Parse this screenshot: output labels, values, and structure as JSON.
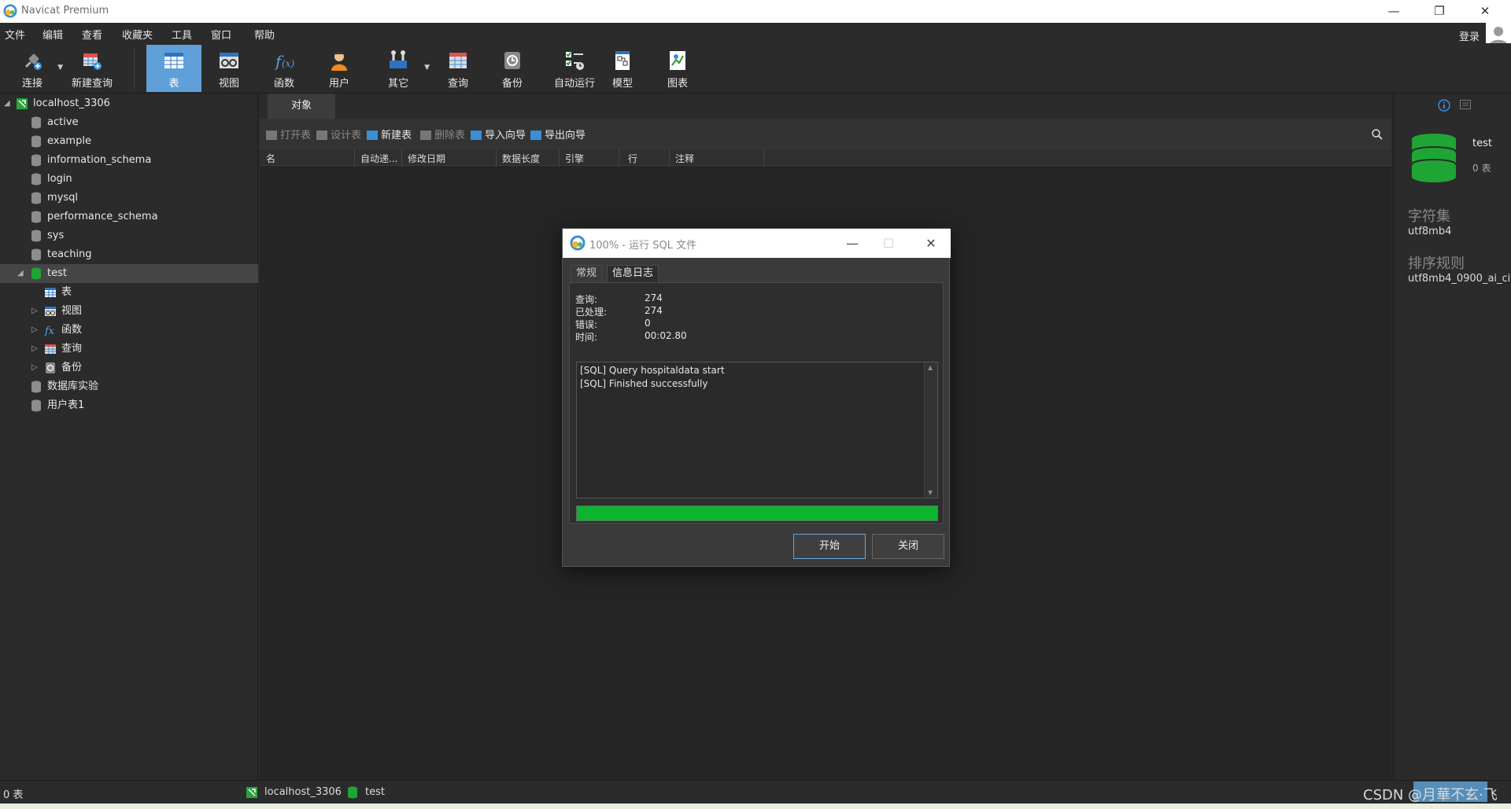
{
  "app": {
    "title": "Navicat Premium"
  },
  "menu": [
    "文件",
    "编辑",
    "查看",
    "收藏夹",
    "工具",
    "窗口",
    "帮助"
  ],
  "login_label": "登录",
  "toolbar": [
    {
      "label": "连接",
      "icon": "plug-icon",
      "has_dropdown": true
    },
    {
      "label": "新建查询",
      "icon": "new-query-icon",
      "has_dropdown": false
    },
    {
      "label": "表",
      "icon": "table-icon",
      "active": true
    },
    {
      "label": "视图",
      "icon": "view-icon"
    },
    {
      "label": "函数",
      "icon": "function-icon"
    },
    {
      "label": "用户",
      "icon": "user-icon"
    },
    {
      "label": "其它",
      "icon": "tools-icon",
      "has_dropdown": true
    },
    {
      "label": "查询",
      "icon": "query-icon"
    },
    {
      "label": "备份",
      "icon": "backup-icon"
    },
    {
      "label": "自动运行",
      "icon": "autorun-icon"
    },
    {
      "label": "模型",
      "icon": "model-icon"
    },
    {
      "label": "图表",
      "icon": "chart-icon"
    }
  ],
  "tree": {
    "connection": "localhost_3306",
    "databases": [
      "active",
      "example",
      "information_schema",
      "login",
      "mysql",
      "performance_schema",
      "sys",
      "teaching",
      "test",
      "数据库实验",
      "用户表1"
    ],
    "selected_db": "test",
    "test_children": [
      "表",
      "视图",
      "函数",
      "查询",
      "备份"
    ]
  },
  "center": {
    "tab": "对象",
    "actions": [
      {
        "label": "打开表",
        "enabled": false
      },
      {
        "label": "设计表",
        "enabled": false
      },
      {
        "label": "新建表",
        "enabled": true
      },
      {
        "label": "删除表",
        "enabled": false
      },
      {
        "label": "导入向导",
        "enabled": true
      },
      {
        "label": "导出向导",
        "enabled": true
      }
    ],
    "columns": [
      "名",
      "自动递...",
      "修改日期",
      "数据长度",
      "引擎",
      "行",
      "注释"
    ]
  },
  "right_panel": {
    "db_name": "test",
    "table_count": "0 表",
    "charset_title": "字符集",
    "charset_value": "utf8mb4",
    "collation_title": "排序规则",
    "collation_value": "utf8mb4_0900_ai_ci"
  },
  "status": {
    "tables": "0 表",
    "connection": "localhost_3306",
    "database": "test"
  },
  "dialog": {
    "title": "100% - 运行 SQL 文件",
    "tabs": [
      "常规",
      "信息日志"
    ],
    "active_tab": "信息日志",
    "stats": [
      {
        "k": "查询:",
        "v": "274"
      },
      {
        "k": "已处理:",
        "v": "274"
      },
      {
        "k": "错误:",
        "v": "0"
      },
      {
        "k": "时间:",
        "v": "00:02.80"
      }
    ],
    "log": [
      "[SQL] Query hospitaldata start",
      "[SQL] Finished successfully"
    ],
    "progress": 1.0,
    "start_button": "开始",
    "close_button": "关闭"
  },
  "watermark": "CSDN @月華不玄·飞",
  "colors": {
    "accent": "#5fa0d8",
    "progress": "#0db42e",
    "db_green": "#1fa535"
  }
}
